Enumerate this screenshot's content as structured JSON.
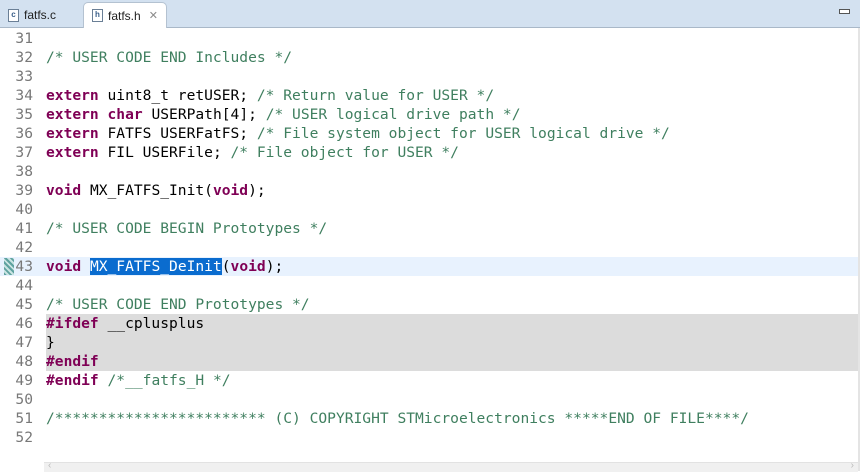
{
  "tabs": [
    {
      "label": "fatfs.c",
      "icon": "c-file-icon",
      "glyph": "c",
      "active": false
    },
    {
      "label": "fatfs.h",
      "icon": "h-file-icon",
      "glyph": "h",
      "active": true
    }
  ],
  "close_glyph": "✕",
  "current_line": 43,
  "inactive_lines": [
    46,
    47,
    48
  ],
  "selection": "MX_FATFS_DeInit",
  "lines": [
    {
      "n": "31",
      "s": []
    },
    {
      "n": "32",
      "s": [
        [
          "cm",
          "/* USER CODE END Includes */"
        ]
      ]
    },
    {
      "n": "33",
      "s": []
    },
    {
      "n": "34",
      "s": [
        [
          "kw",
          "extern"
        ],
        [
          "tx",
          " uint8_t retUSER; "
        ],
        [
          "cm",
          "/* Return value for USER */"
        ]
      ]
    },
    {
      "n": "35",
      "s": [
        [
          "kw",
          "extern"
        ],
        [
          "tx",
          " "
        ],
        [
          "kw",
          "char"
        ],
        [
          "tx",
          " USERPath[4]; "
        ],
        [
          "cm",
          "/* USER logical drive path */"
        ]
      ]
    },
    {
      "n": "36",
      "s": [
        [
          "kw",
          "extern"
        ],
        [
          "tx",
          " FATFS USERFatFS; "
        ],
        [
          "cm",
          "/* File system object for USER logical drive */"
        ]
      ]
    },
    {
      "n": "37",
      "s": [
        [
          "kw",
          "extern"
        ],
        [
          "tx",
          " FIL USERFile; "
        ],
        [
          "cm",
          "/* File object for USER */"
        ]
      ]
    },
    {
      "n": "38",
      "s": []
    },
    {
      "n": "39",
      "s": [
        [
          "kw",
          "void"
        ],
        [
          "tx",
          " MX_FATFS_Init("
        ],
        [
          "kw",
          "void"
        ],
        [
          "tx",
          ");"
        ]
      ]
    },
    {
      "n": "40",
      "s": []
    },
    {
      "n": "41",
      "s": [
        [
          "cm",
          "/* USER CODE BEGIN Prototypes */"
        ]
      ]
    },
    {
      "n": "42",
      "s": []
    },
    {
      "n": "43",
      "s": [
        [
          "kw",
          "void"
        ],
        [
          "tx",
          " "
        ],
        [
          "sel",
          "MX_FATFS_DeInit"
        ],
        [
          "tx",
          "("
        ],
        [
          "kw",
          "void"
        ],
        [
          "tx",
          ");"
        ]
      ]
    },
    {
      "n": "44",
      "s": []
    },
    {
      "n": "45",
      "s": [
        [
          "cm",
          "/* USER CODE END Prototypes */"
        ]
      ]
    },
    {
      "n": "46",
      "s": [
        [
          "kw",
          "#ifdef"
        ],
        [
          "tx",
          " __cplusplus"
        ]
      ]
    },
    {
      "n": "47",
      "s": [
        [
          "tx",
          "}"
        ]
      ]
    },
    {
      "n": "48",
      "s": [
        [
          "kw",
          "#endif"
        ]
      ]
    },
    {
      "n": "49",
      "s": [
        [
          "kw",
          "#endif"
        ],
        [
          "tx",
          " "
        ],
        [
          "cm",
          "/*__fatfs_H */"
        ]
      ]
    },
    {
      "n": "50",
      "s": []
    },
    {
      "n": "51",
      "s": [
        [
          "cm",
          "/************************ (C) COPYRIGHT STMicroelectronics *****END OF FILE****/"
        ]
      ]
    },
    {
      "n": "52",
      "s": []
    }
  ],
  "colors": {
    "keyword": "#7f0055",
    "comment": "#3f7f5f",
    "selection": "#0a6ccf",
    "line_number": "#787878"
  }
}
